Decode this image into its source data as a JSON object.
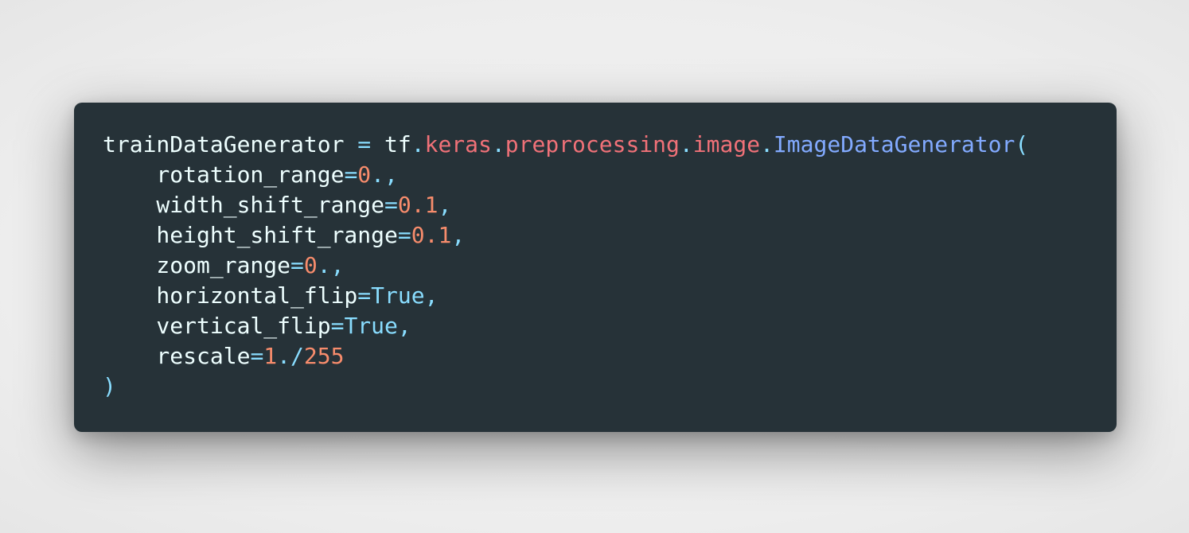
{
  "colors": {
    "background": "#ededed",
    "editor_bg": "#263238",
    "identifier": "#eeffff",
    "operator": "#89ddff",
    "property": "#f07178",
    "function": "#82aaff",
    "number": "#f78c6c",
    "constant": "#89ddff"
  },
  "code": {
    "lines": [
      [
        {
          "t": "trainDataGenerator",
          "c": "ident"
        },
        {
          "t": " ",
          "c": "ident"
        },
        {
          "t": "=",
          "c": "op"
        },
        {
          "t": " ",
          "c": "ident"
        },
        {
          "t": "tf",
          "c": "ident"
        },
        {
          "t": ".",
          "c": "punct"
        },
        {
          "t": "keras",
          "c": "prop"
        },
        {
          "t": ".",
          "c": "punct"
        },
        {
          "t": "preprocessing",
          "c": "prop"
        },
        {
          "t": ".",
          "c": "punct"
        },
        {
          "t": "image",
          "c": "prop"
        },
        {
          "t": ".",
          "c": "punct"
        },
        {
          "t": "ImageDataGenerator",
          "c": "func"
        },
        {
          "t": "(",
          "c": "punct"
        }
      ],
      [
        {
          "t": "    rotation_range",
          "c": "ident"
        },
        {
          "t": "=",
          "c": "op"
        },
        {
          "t": "0",
          "c": "num"
        },
        {
          "t": ".,",
          "c": "punct"
        }
      ],
      [
        {
          "t": "    width_shift_range",
          "c": "ident"
        },
        {
          "t": "=",
          "c": "op"
        },
        {
          "t": "0.1",
          "c": "num"
        },
        {
          "t": ",",
          "c": "punct"
        }
      ],
      [
        {
          "t": "    height_shift_range",
          "c": "ident"
        },
        {
          "t": "=",
          "c": "op"
        },
        {
          "t": "0.1",
          "c": "num"
        },
        {
          "t": ",",
          "c": "punct"
        }
      ],
      [
        {
          "t": "    zoom_range",
          "c": "ident"
        },
        {
          "t": "=",
          "c": "op"
        },
        {
          "t": "0",
          "c": "num"
        },
        {
          "t": ".,",
          "c": "punct"
        }
      ],
      [
        {
          "t": "    horizontal_flip",
          "c": "ident"
        },
        {
          "t": "=",
          "c": "op"
        },
        {
          "t": "True",
          "c": "kw"
        },
        {
          "t": ",",
          "c": "punct"
        }
      ],
      [
        {
          "t": "    vertical_flip",
          "c": "ident"
        },
        {
          "t": "=",
          "c": "op"
        },
        {
          "t": "True",
          "c": "kw"
        },
        {
          "t": ",",
          "c": "punct"
        }
      ],
      [
        {
          "t": "    rescale",
          "c": "ident"
        },
        {
          "t": "=",
          "c": "op"
        },
        {
          "t": "1",
          "c": "num"
        },
        {
          "t": "./",
          "c": "punct"
        },
        {
          "t": "255",
          "c": "num"
        }
      ],
      [
        {
          "t": ")",
          "c": "punct"
        }
      ]
    ]
  }
}
